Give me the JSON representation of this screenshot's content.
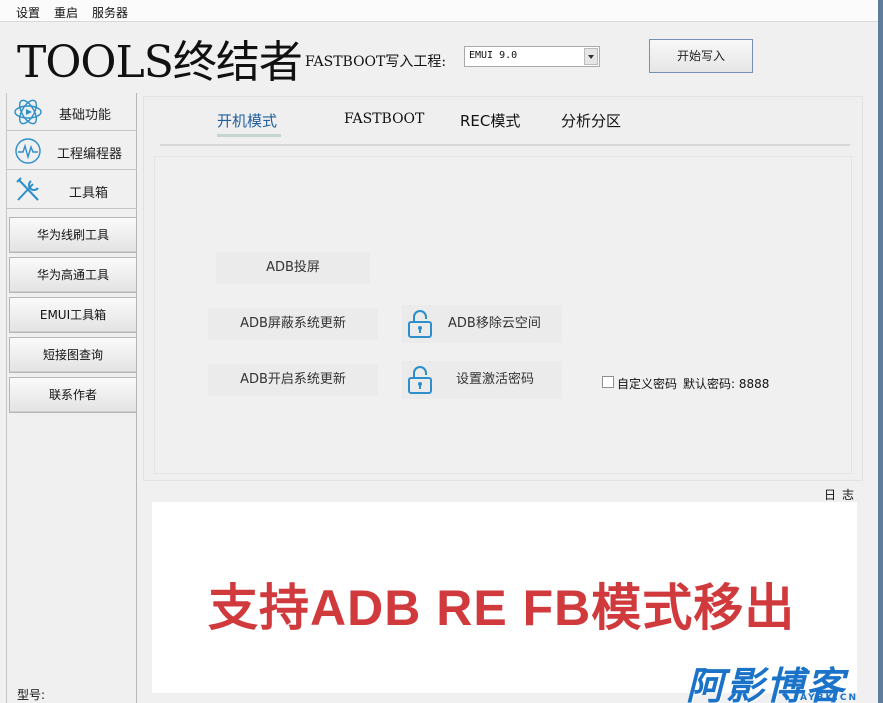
{
  "menubar": {
    "items": [
      "设置",
      "重启",
      "服务器"
    ]
  },
  "header": {
    "logo_text": "TOOLS终结者",
    "fastboot_label": "FASTBOOT写入工程:",
    "project_select_value": "EMUI 9.0",
    "start_button": "开始写入"
  },
  "sidebar": {
    "nav": [
      {
        "label": "基础功能",
        "icon": "atom-icon"
      },
      {
        "label": "工程编程器",
        "icon": "wave-icon"
      },
      {
        "label": "工具箱",
        "icon": "tools-icon"
      }
    ],
    "buttons": [
      "华为线刷工具",
      "华为高通工具",
      "EMUI工具箱",
      "短接图查询",
      "联系作者"
    ],
    "model_label": "型号:"
  },
  "tabs": [
    "开机模式",
    "FASTBOOT",
    "REC模式",
    "分析分区"
  ],
  "actions": {
    "adb_cast": "ADB投屏",
    "adb_block_update": "ADB屏蔽系统更新",
    "adb_enable_update": "ADB开启系统更新",
    "adb_remove_cloud": "ADB移除云空间",
    "set_activation_pwd": "设置激活密码",
    "custom_pwd": "自定义密码",
    "default_pwd": "默认密码: 8888"
  },
  "log": {
    "label": "日志",
    "overlay_caption": "支持ADB RE FB模式移出"
  },
  "watermark": {
    "main": "阿影博客",
    "sub": "AYBK.CN"
  },
  "colors": {
    "accent_blue": "#1a73c9",
    "caption_red": "#d03a3d",
    "tab_underline": "#c5d6cf"
  }
}
